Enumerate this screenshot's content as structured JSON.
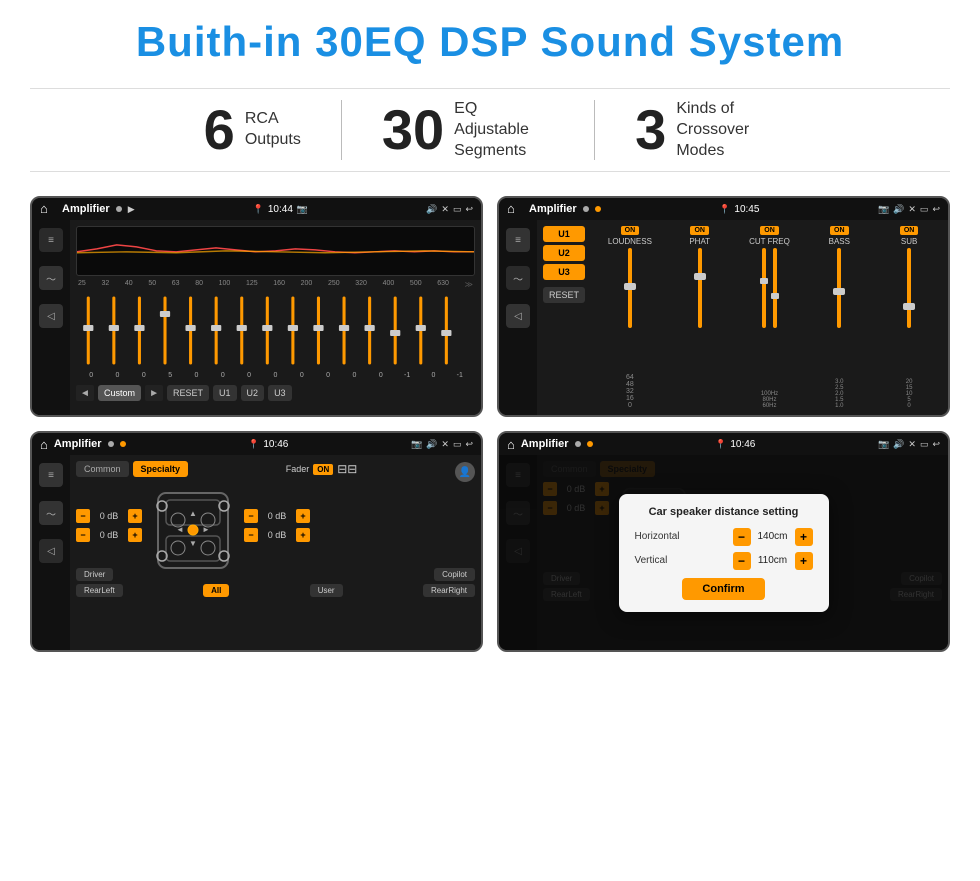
{
  "header": {
    "title": "Buith-in 30EQ DSP Sound System"
  },
  "stats": [
    {
      "number": "6",
      "label": "RCA\nOutputs"
    },
    {
      "number": "30",
      "label": "EQ Adjustable\nSegments"
    },
    {
      "number": "3",
      "label": "Kinds of\nCrossover Modes"
    }
  ],
  "screens": [
    {
      "id": "screen1",
      "status": {
        "app": "Amplifier",
        "time": "10:44"
      },
      "eq_freqs": [
        "25",
        "32",
        "40",
        "50",
        "63",
        "80",
        "100",
        "125",
        "160",
        "200",
        "250",
        "320",
        "400",
        "500",
        "630"
      ],
      "eq_values": [
        "0",
        "0",
        "0",
        "5",
        "0",
        "0",
        "0",
        "0",
        "0",
        "0",
        "0",
        "0",
        "-1",
        "0",
        "-1"
      ],
      "eq_preset": "Custom",
      "buttons": [
        "RESET",
        "U1",
        "U2",
        "U3"
      ]
    },
    {
      "id": "screen2",
      "status": {
        "app": "Amplifier",
        "time": "10:45"
      },
      "user_tabs": [
        "U1",
        "U2",
        "U3"
      ],
      "columns": [
        {
          "label": "LOUDNESS",
          "on": true
        },
        {
          "label": "PHAT",
          "on": true
        },
        {
          "label": "CUT FREQ",
          "on": true
        },
        {
          "label": "BASS",
          "on": true
        },
        {
          "label": "SUB",
          "on": true
        }
      ],
      "reset_label": "RESET"
    },
    {
      "id": "screen3",
      "status": {
        "app": "Amplifier",
        "time": "10:46"
      },
      "tabs": [
        "Common",
        "Specialty"
      ],
      "active_tab": "Specialty",
      "fader_label": "Fader",
      "fader_on": "ON",
      "db_values": [
        "0 dB",
        "0 dB",
        "0 dB",
        "0 dB"
      ],
      "buttons": {
        "driver": "Driver",
        "copilot": "Copilot",
        "rear_left": "RearLeft",
        "all": "All",
        "user": "User",
        "rear_right": "RearRight"
      }
    },
    {
      "id": "screen4",
      "status": {
        "app": "Amplifier",
        "time": "10:46"
      },
      "tabs": [
        "Common",
        "Specialty"
      ],
      "dialog": {
        "title": "Car speaker distance setting",
        "fields": [
          {
            "label": "Horizontal",
            "value": "140cm"
          },
          {
            "label": "Vertical",
            "value": "110cm"
          }
        ],
        "confirm_label": "Confirm"
      },
      "buttons": {
        "driver": "Driver",
        "copilot": "Copilot",
        "rear_left": "RearLeft",
        "user": "User",
        "rear_right": "RearRight"
      }
    }
  ]
}
